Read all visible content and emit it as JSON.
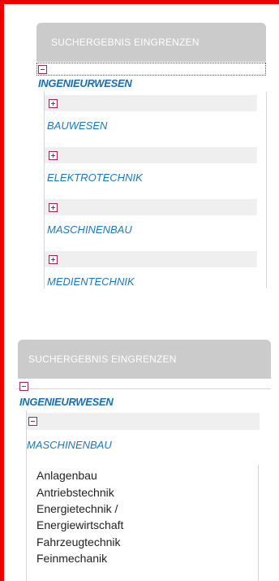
{
  "panel1": {
    "header": "SUCHERGEBNIS EINGRENZEN",
    "root": "INGENIEURWESEN",
    "categories": [
      "BAUWESEN",
      "ELEKTROTECHNIK",
      "MASCHINENBAU",
      "MEDIENTECHNIK"
    ]
  },
  "panel2": {
    "header": "SUCHERGEBNIS EINGRENZEN",
    "root": "INGENIEURWESEN",
    "category": "MASCHINENBAU",
    "subitems": [
      "Anlagenbau",
      "Antriebstechnik",
      "Energietechnik /",
      "Energiewirtschaft",
      "Fahrzeugtechnik",
      "Feinmechanik"
    ]
  },
  "colors": {
    "frame": "#ee0000",
    "link": "#1a6fb3",
    "toggle": "#9a2a55",
    "header_bg": "#cbcbcb"
  },
  "icons": {
    "expand": "plus-box-icon",
    "collapse": "minus-box-icon"
  }
}
